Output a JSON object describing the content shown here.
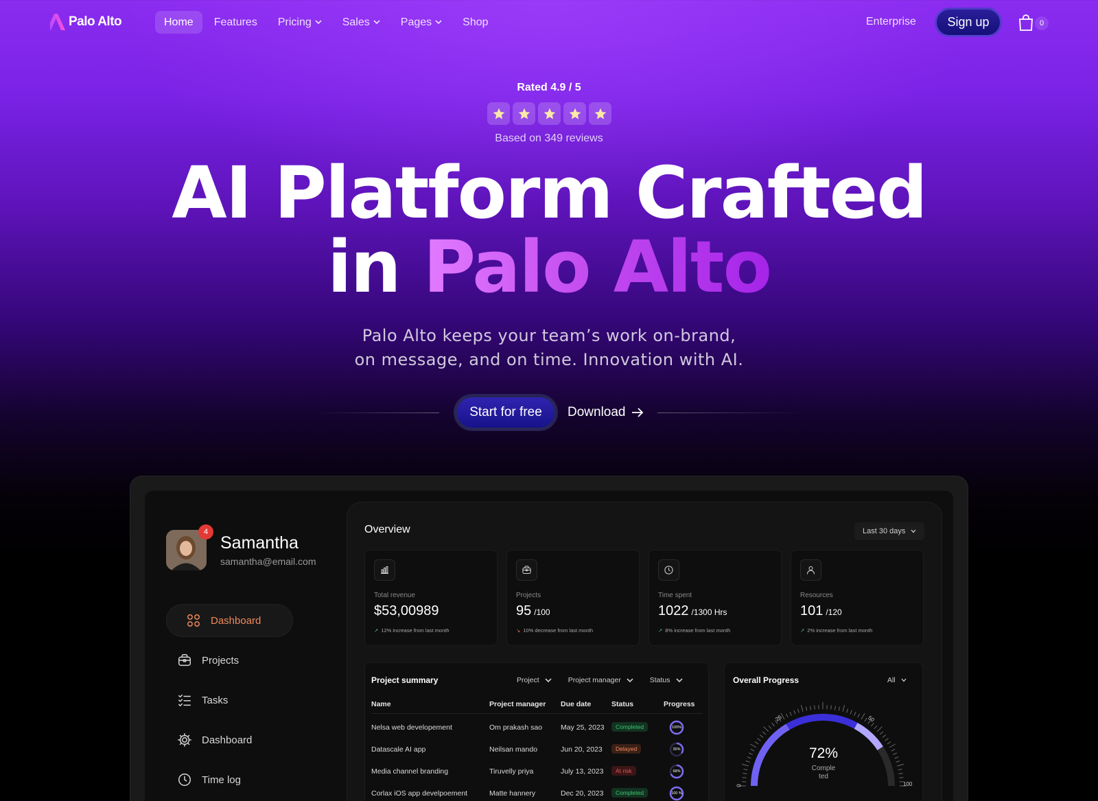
{
  "brand": {
    "name": "Palo Alto"
  },
  "nav": {
    "links": [
      {
        "label": "Home",
        "dropdown": false,
        "active": true
      },
      {
        "label": "Features",
        "dropdown": false
      },
      {
        "label": "Pricing",
        "dropdown": true
      },
      {
        "label": "Sales",
        "dropdown": true
      },
      {
        "label": "Pages",
        "dropdown": true
      },
      {
        "label": "Shop",
        "dropdown": false
      }
    ],
    "enterprise": "Enterprise",
    "signup": "Sign up",
    "cart_count": "0"
  },
  "hero": {
    "rating": "Rated 4.9 / 5",
    "stars": 5,
    "reviews": "Based on 349 reviews",
    "headline_1": "AI Platform Crafted",
    "headline_2a": "in ",
    "headline_2b": "Palo Alto",
    "subtitle_1": "Palo Alto keeps your team’s work on-brand,",
    "subtitle_2": "on message, and on time. Innovation with AI.",
    "cta_primary": "Start for free",
    "cta_secondary": "Download"
  },
  "dashboard": {
    "user": {
      "name": "Samantha",
      "email": "samantha@email.com",
      "notifications": "4"
    },
    "sidebar": [
      {
        "label": "Dashboard",
        "icon": "grid-icon",
        "active": true
      },
      {
        "label": "Projects",
        "icon": "briefcase-icon"
      },
      {
        "label": "Tasks",
        "icon": "list-check-icon"
      },
      {
        "label": "Dashboard",
        "icon": "gear-cog-icon"
      },
      {
        "label": "Time log",
        "icon": "clock-icon"
      }
    ],
    "overview": {
      "title": "Overview",
      "range": "Last 30 days",
      "cards": [
        {
          "icon": "bar-chart-icon",
          "label": "Total revenue",
          "value": "$53,00989",
          "suffix": "",
          "note": "12% increase from last month",
          "trend": "up"
        },
        {
          "icon": "briefcase-icon",
          "label": "Projects",
          "value": "95",
          "suffix": "/100",
          "note": "10% decrease from last month",
          "trend": "down"
        },
        {
          "icon": "clock-icon",
          "label": "Time spent",
          "value": "1022",
          "suffix": "/1300 Hrs",
          "note": "8% increase from last month",
          "trend": "up"
        },
        {
          "icon": "user-icon",
          "label": "Resources",
          "value": "101",
          "suffix": "/120",
          "note": "2% increase from last month",
          "trend": "up"
        }
      ]
    },
    "summary": {
      "title": "Project summary",
      "filters": [
        "Project",
        "Project manager",
        "Status"
      ],
      "columns": [
        "Name",
        "Project manager",
        "Due date",
        "Status",
        "Progress"
      ],
      "rows": [
        {
          "name": "Nelsa web developement",
          "manager": "Om prakash sao",
          "due": "May 25, 2023",
          "status": "Completed",
          "status_type": "done",
          "progress": 1.0,
          "progress_label": "100%"
        },
        {
          "name": "Datascale AI app",
          "manager": "Neilsan mando",
          "due": "Jun 20, 2023",
          "status": "Delayed",
          "status_type": "delay",
          "progress": 0.35,
          "progress_label": "35%"
        },
        {
          "name": "Media channel branding",
          "manager": "Tiruvelly priya",
          "due": "July 13, 2023",
          "status": "At risk",
          "status_type": "risk",
          "progress": 0.68,
          "progress_label": "68%"
        },
        {
          "name": "Corlax iOS app develpoement",
          "manager": "Matte hannery",
          "due": "Dec 20, 2023",
          "status": "Completed",
          "status_type": "done",
          "progress": 1.0,
          "progress_label": "100 %"
        }
      ]
    },
    "overall": {
      "title": "Overall Progress",
      "filter": "All",
      "percent": "72%",
      "label_1": "Comple",
      "label_2": "ted",
      "value": 0.72,
      "ticks": [
        "0",
        "25",
        "50",
        "100"
      ]
    }
  },
  "colors": {
    "accent": "#a524e8",
    "cta": "#1f18a0",
    "sidebar_active": "#f08a5d",
    "up": "#3ec46d",
    "down": "#f26a4a"
  }
}
